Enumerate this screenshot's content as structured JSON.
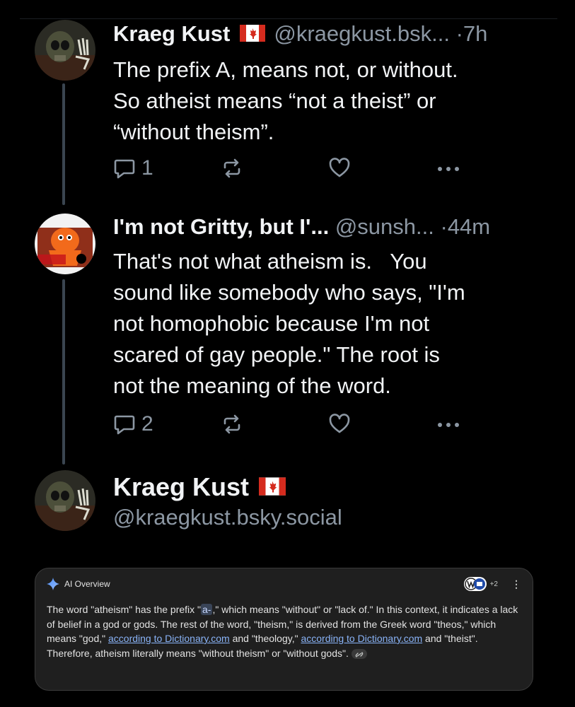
{
  "posts": [
    {
      "author": "Kraeg Kust",
      "flag": "🇨🇦",
      "handle": "@kraegkust.bsk...",
      "separator": "·",
      "time": "7h",
      "text": "The prefix A, means not, or without.\nSo atheist means “not a theist” or\n“without theism”.",
      "reply_count": "1"
    },
    {
      "author": "I'm not Gritty, but I'...",
      "handle": "@sunsh...",
      "separator": "·",
      "time": "44m",
      "text": "That's not what atheism is.   You\nsound like somebody who says, \"I'm\nnot homophobic because I'm not\nscared of gay people.\" The root is\nnot the meaning of the word.",
      "reply_count": "2"
    }
  ],
  "profile": {
    "author": "Kraeg Kust",
    "flag": "🇨🇦",
    "handle": "@kraegkust.bsky.social"
  },
  "ai_overview": {
    "label": "AI Overview",
    "sources_more": "+2",
    "text_1": "The word \"atheism\" has the prefix \"",
    "highlight": "a-",
    "text_2": ",\" which means \"without\" or \"lack of.\" In this context, it indicates a lack of belief in a god or gods. The rest of the word, \"theism,\" is derived from the Greek word \"theos,\" which means \"god,\" ",
    "link_1": "according to Dictionary.com",
    "text_3": " and \"theology,\" ",
    "link_2": "according to Dictionary.com",
    "text_4": " and \"theist\". Therefore, atheism literally means \"without theism\" or \"without gods\"."
  },
  "colors": {
    "background": "#000000",
    "text": "#f1f3f5",
    "muted": "#8c97a3",
    "thread_line": "#3a4550",
    "link": "#8ab4f8",
    "flag_red": "#d52b1e"
  },
  "icons": [
    "reply-icon",
    "repost-icon",
    "like-icon",
    "more-icon",
    "sparkle-icon",
    "link-icon",
    "canada-flag-icon"
  ]
}
